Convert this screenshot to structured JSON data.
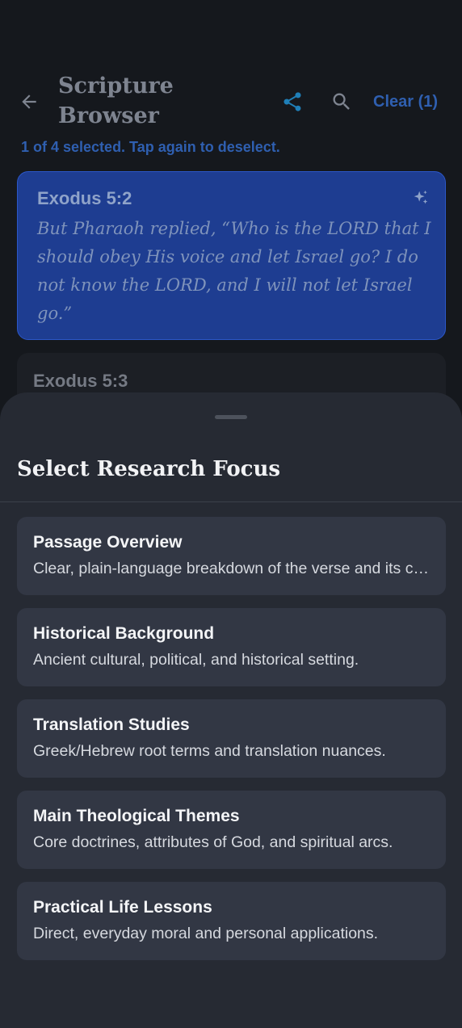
{
  "appbar": {
    "title": "Scripture Browser",
    "clear_label": "Clear (1)"
  },
  "selection_hint": "1 of 4 selected. Tap again to deselect.",
  "verses": [
    {
      "reference": "Exodus 5:2",
      "text": "But Pharaoh replied, “Who is the LORD that I should obey His voice and let Israel go? I do not know the LORD, and I will not let Israel go.”",
      "selected": true
    },
    {
      "reference": "Exodus 5:3",
      "selected": false
    }
  ],
  "sheet": {
    "title": "Select Research Focus",
    "options": [
      {
        "title": "Passage Overview",
        "description": "Clear, plain-language breakdown of the verse and its context."
      },
      {
        "title": "Historical Background",
        "description": "Ancient cultural, political, and historical setting."
      },
      {
        "title": "Translation Studies",
        "description": "Greek/Hebrew root terms and translation nuances."
      },
      {
        "title": "Main Theological Themes",
        "description": "Core doctrines, attributes of God, and spiritual arcs."
      },
      {
        "title": "Practical Life Lessons",
        "description": "Direct, everyday moral and personal applications."
      }
    ]
  },
  "colors": {
    "accent": "#2f5fb0",
    "selected_card": "#1e3d91",
    "sheet_bg": "#262a33",
    "option_bg": "#323744"
  }
}
